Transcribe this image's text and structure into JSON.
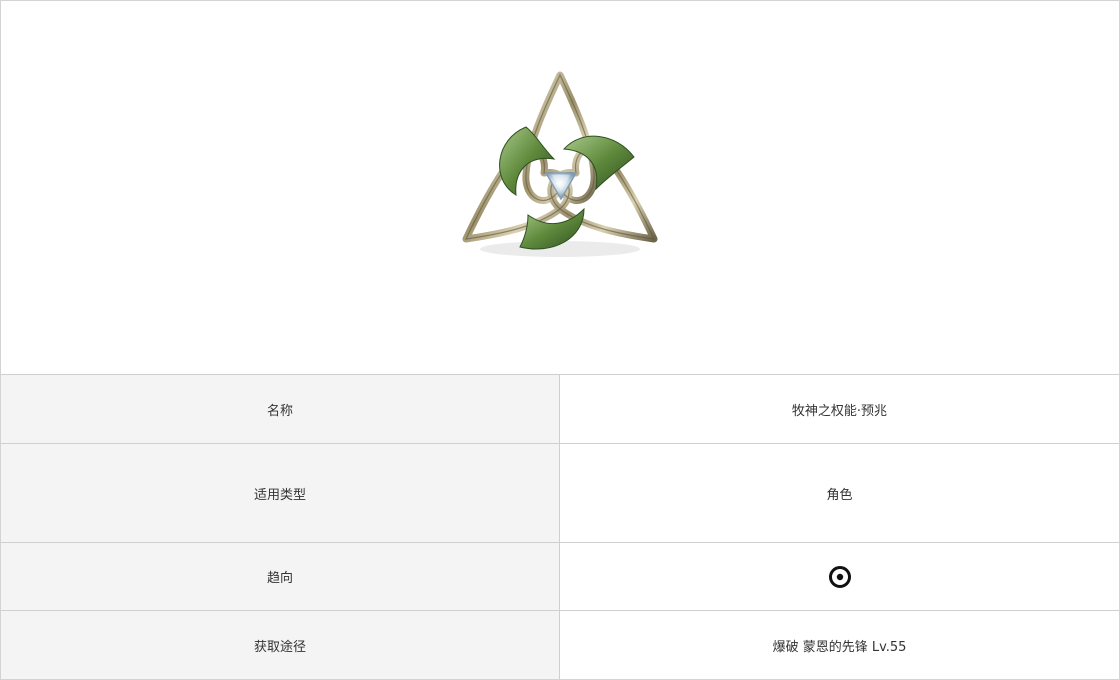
{
  "colors": {
    "label_bg": "#f4f4f4",
    "value_bg": "#ffffff",
    "border": "#cfcfcf",
    "text": "#333333",
    "emblem_gold": "#b8ad86",
    "emblem_green": "#5f8a3c",
    "emblem_gem": "#c9dbe8"
  },
  "item": {
    "image_icon": "triquetra-emblem-icon",
    "tendency_icon": "target-circle-icon"
  },
  "rows": [
    {
      "label": "名称",
      "value": "牧神之权能·预兆"
    },
    {
      "label": "适用类型",
      "value": "角色"
    },
    {
      "label": "趋向",
      "value": ""
    },
    {
      "label": "获取途径",
      "value": "爆破 蒙恩的先锋 Lv.55"
    }
  ]
}
